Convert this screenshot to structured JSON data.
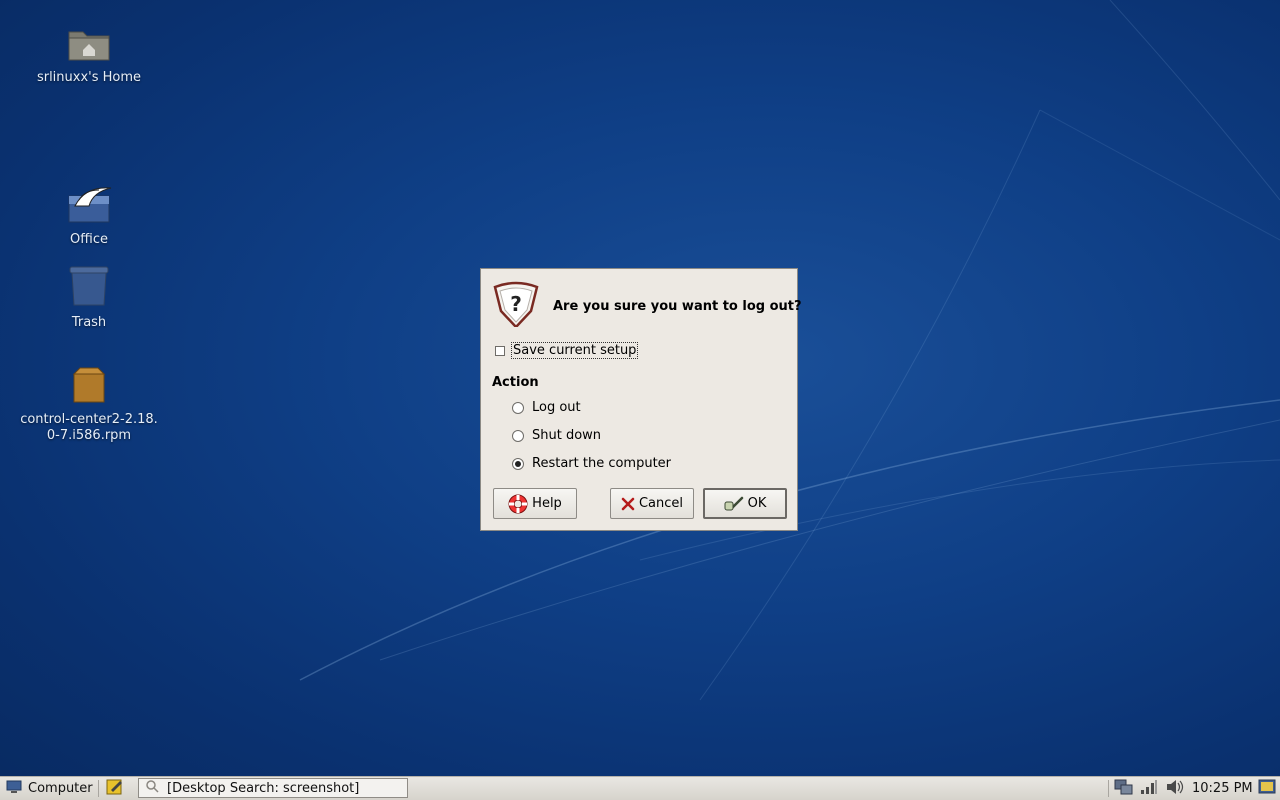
{
  "desktop": {
    "icons": [
      {
        "label": "srlinuxx's Home",
        "icon": "home-folder-icon"
      },
      {
        "label": "Office",
        "icon": "openoffice-icon"
      },
      {
        "label": "Trash",
        "icon": "trash-icon"
      },
      {
        "label_line1": "control-center2-2.18.",
        "label_line2": "0-7.i586.rpm",
        "icon": "package-icon"
      }
    ]
  },
  "dialog": {
    "title": "Are you sure you want to log out?",
    "icon": "question-icon",
    "save_setup_label": "Save current setup",
    "save_setup_checked": false,
    "action_heading": "Action",
    "options": [
      {
        "label": "Log out",
        "selected": false
      },
      {
        "label": "Shut down",
        "selected": false
      },
      {
        "label": "Restart the computer",
        "selected": true
      }
    ],
    "buttons": {
      "help": "Help",
      "cancel": "Cancel",
      "ok": "OK"
    }
  },
  "taskbar": {
    "computer_label": "Computer",
    "search_text": "[Desktop Search: screenshot]",
    "clock": "10:25 PM"
  },
  "colors": {
    "desktop_bg": "#0f3f86",
    "dialog_bg": "#ede9e3",
    "taskbar_bg": "#e0ddd7"
  }
}
